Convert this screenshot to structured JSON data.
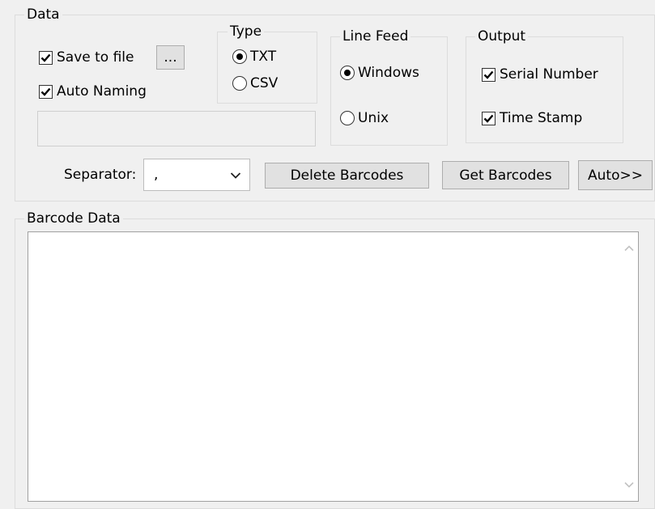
{
  "data_group": {
    "title": "Data",
    "save_to_file": {
      "label": "Save to file",
      "checked": true
    },
    "browse_button": "...",
    "auto_naming": {
      "label": "Auto Naming",
      "checked": true
    },
    "file_path_value": "",
    "type_group": {
      "title": "Type",
      "options": [
        {
          "label": "TXT",
          "selected": true
        },
        {
          "label": "CSV",
          "selected": false
        }
      ]
    },
    "line_feed_group": {
      "title": "Line Feed",
      "options": [
        {
          "label": "Windows",
          "selected": true
        },
        {
          "label": "Unix",
          "selected": false
        }
      ]
    },
    "output_group": {
      "title": "Output",
      "options": [
        {
          "label": "Serial Number",
          "checked": true
        },
        {
          "label": "Time Stamp",
          "checked": true
        }
      ]
    },
    "separator": {
      "label": "Separator:",
      "value": ","
    },
    "buttons": {
      "delete_barcodes": "Delete Barcodes",
      "get_barcodes": "Get Barcodes",
      "auto": "Auto>>"
    }
  },
  "barcode_data_group": {
    "title": "Barcode Data",
    "content": ""
  },
  "icons": {
    "checkmark": "checkmark-icon",
    "radio_dot": "radio-dot-icon",
    "dropdown": "chevron-down-icon",
    "scroll_up": "scroll-up-arrow-icon",
    "scroll_down": "scroll-down-arrow-icon"
  },
  "colors": {
    "panel_background": "#f0f0f0",
    "button_background": "#e1e1e1",
    "border": "#dcdcdc",
    "input_background": "#ffffff"
  }
}
